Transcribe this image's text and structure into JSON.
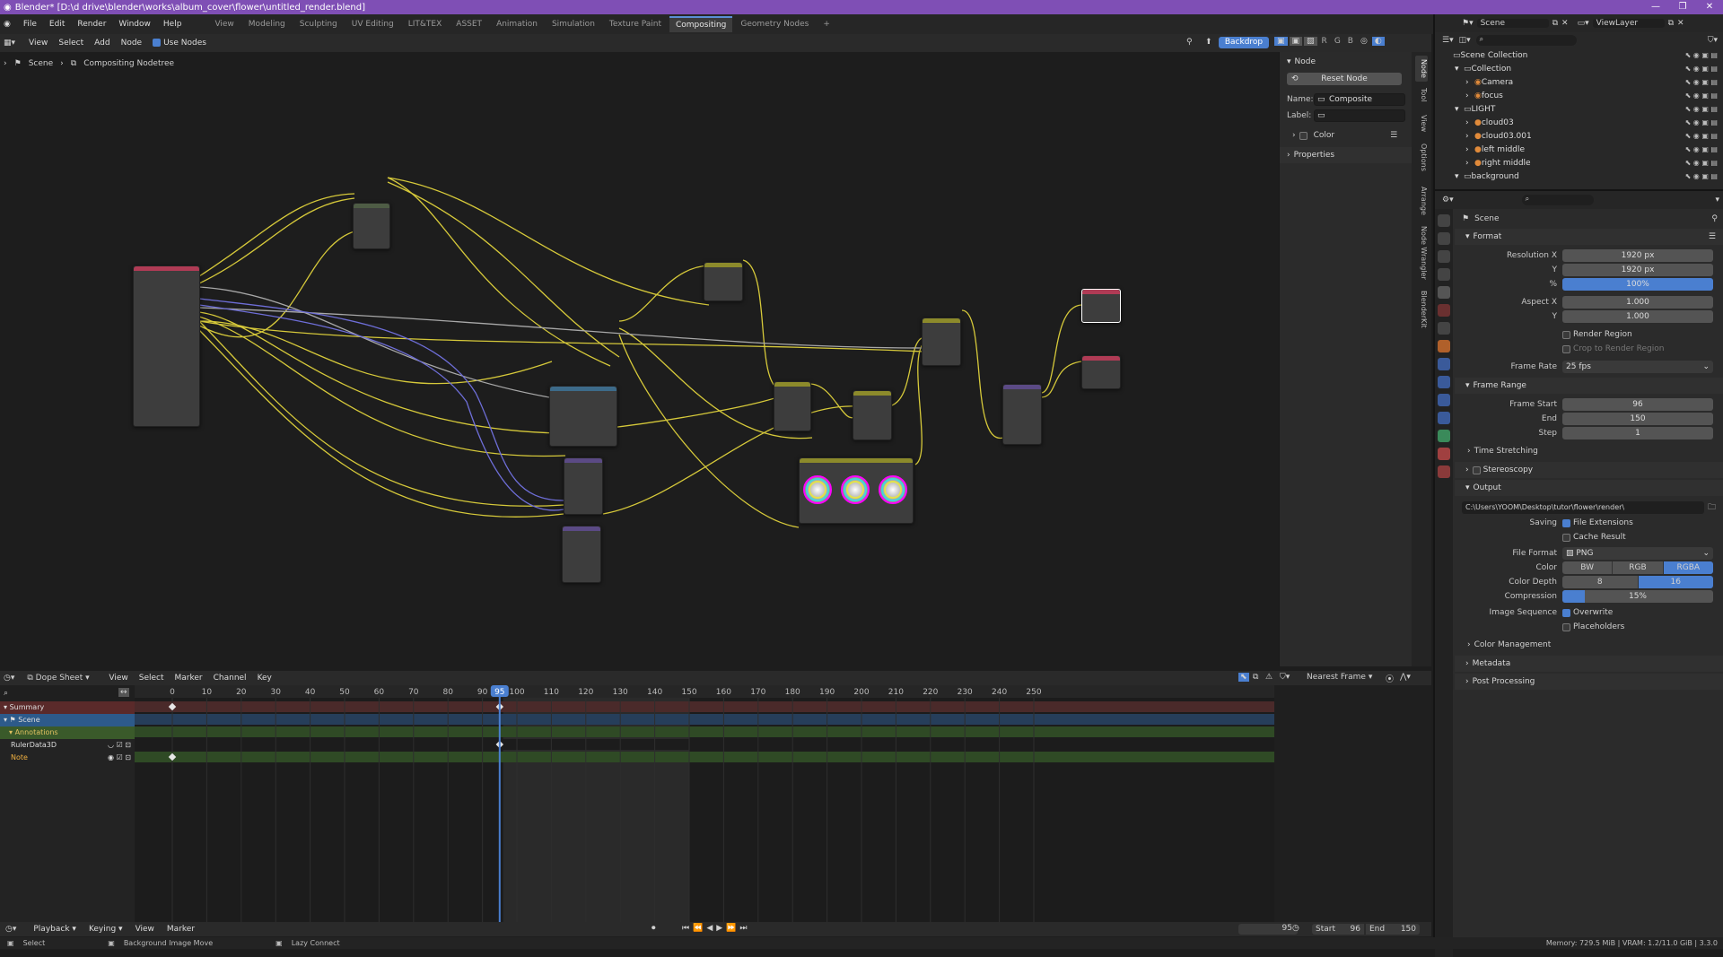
{
  "titlebar": {
    "title": "Blender* [D:\\d drive\\blender\\works\\album_cover\\flower\\untitled_render.blend]",
    "minimize": "—",
    "maximize": "❐",
    "close": "✕"
  },
  "menus": [
    "File",
    "Edit",
    "Render",
    "Window",
    "Help"
  ],
  "workspaces": [
    "View",
    "Modeling",
    "Sculpting",
    "UV Editing",
    "LIT&TEX",
    "ASSET",
    "Animation",
    "Simulation",
    "Texture Paint",
    "Compositing",
    "Geometry Nodes",
    "+"
  ],
  "active_workspace": "Compositing",
  "scene_selector": {
    "scene": "Scene",
    "view_layer": "ViewLayer"
  },
  "node_header": {
    "items": [
      "View",
      "Select",
      "Add",
      "Node"
    ],
    "use_nodes": "Use Nodes",
    "backdrop": "Backdrop",
    "channels": [
      "R",
      "G",
      "B"
    ]
  },
  "breadcrumb": {
    "scene": "Scene",
    "tree": "Compositing Nodetree",
    "sep": "›"
  },
  "node_sidebar": {
    "section": "Node",
    "reset": "Reset Node",
    "name_label": "Name:",
    "name_value": "Composite",
    "label_label": "Label:",
    "label_value": "",
    "color": "Color",
    "properties": "Properties"
  },
  "vtabs": [
    "Node",
    "Tool",
    "View",
    "Options",
    "Arrange",
    "Node Wrangler",
    "BlenderKit"
  ],
  "dopesheet": {
    "mode": "Dope Sheet",
    "menu": [
      "View",
      "Select",
      "Marker",
      "Channel",
      "Key"
    ],
    "snap": "Nearest Frame",
    "ticks": [
      "0",
      "10",
      "20",
      "30",
      "40",
      "50",
      "60",
      "70",
      "80",
      "90",
      "95",
      "100",
      "110",
      "120",
      "130",
      "140",
      "150",
      "160",
      "170",
      "180",
      "190",
      "200",
      "210",
      "220",
      "230",
      "240",
      "250"
    ],
    "current_frame": "95",
    "channels": [
      {
        "label": "Summary",
        "color": "#5a2a2a"
      },
      {
        "label": "Scene",
        "color": "#2d5a8a"
      },
      {
        "label": "Annotations",
        "color": "#3a5a2a"
      },
      {
        "label": "RulerData3D",
        "color": "#232323"
      },
      {
        "label": "Note",
        "color": "#232323"
      }
    ]
  },
  "playback": {
    "items": [
      "Playback",
      "Keying",
      "View",
      "Marker"
    ],
    "frame": "95",
    "start_label": "Start",
    "start": "96",
    "end_label": "End",
    "end": "150"
  },
  "statusbar": {
    "select": "Select",
    "move": "Background Image Move",
    "lazy": "Lazy Connect",
    "memory": "Memory: 729.5 MiB | VRAM: 1.2/11.0 GiB | 3.3.0"
  },
  "outliner": {
    "rows": [
      {
        "label": "Scene Collection",
        "depth": 0
      },
      {
        "label": "Collection",
        "depth": 1
      },
      {
        "label": "Camera",
        "depth": 2
      },
      {
        "label": "focus",
        "depth": 2
      },
      {
        "label": "LIGHT",
        "depth": 1
      },
      {
        "label": "cloud03",
        "depth": 2
      },
      {
        "label": "cloud03.001",
        "depth": 2
      },
      {
        "label": "left middle",
        "depth": 2
      },
      {
        "label": "right middle",
        "depth": 2
      },
      {
        "label": "background",
        "depth": 1
      }
    ]
  },
  "properties": {
    "scene": "Scene",
    "format_panel": "Format",
    "resolution_x_label": "Resolution X",
    "resolution_x": "1920 px",
    "resolution_y_label": "Y",
    "resolution_y": "1920 px",
    "percent_label": "%",
    "percent": "100%",
    "aspect_x_label": "Aspect X",
    "aspect_x": "1.000",
    "aspect_y_label": "Y",
    "aspect_y": "1.000",
    "render_region": "Render Region",
    "crop_region": "Crop to Render Region",
    "frame_rate_label": "Frame Rate",
    "frame_rate": "25 fps",
    "frame_range_panel": "Frame Range",
    "frame_start_label": "Frame Start",
    "frame_start": "96",
    "end_label": "End",
    "end": "150",
    "step_label": "Step",
    "step": "1",
    "time_stretching": "Time Stretching",
    "stereoscopy": "Stereoscopy",
    "output_panel": "Output",
    "output_path": "C:\\Users\\YOOM\\Desktop\\tutor\\flower\\render\\",
    "saving_label": "Saving",
    "file_extensions": "File Extensions",
    "cache_result": "Cache Result",
    "file_format_label": "File Format",
    "file_format": "PNG",
    "color_label": "Color",
    "color_modes": [
      "BW",
      "RGB",
      "RGBA"
    ],
    "color_active": "RGBA",
    "color_depth_label": "Color Depth",
    "color_depths": [
      "8",
      "16"
    ],
    "color_depth_active": "16",
    "compression_label": "Compression",
    "compression": "15%",
    "compression_value": 0.15,
    "image_sequence_label": "Image Sequence",
    "overwrite": "Overwrite",
    "placeholders": "Placeholders",
    "color_management": "Color Management",
    "metadata": "Metadata",
    "post_processing": "Post Processing"
  }
}
